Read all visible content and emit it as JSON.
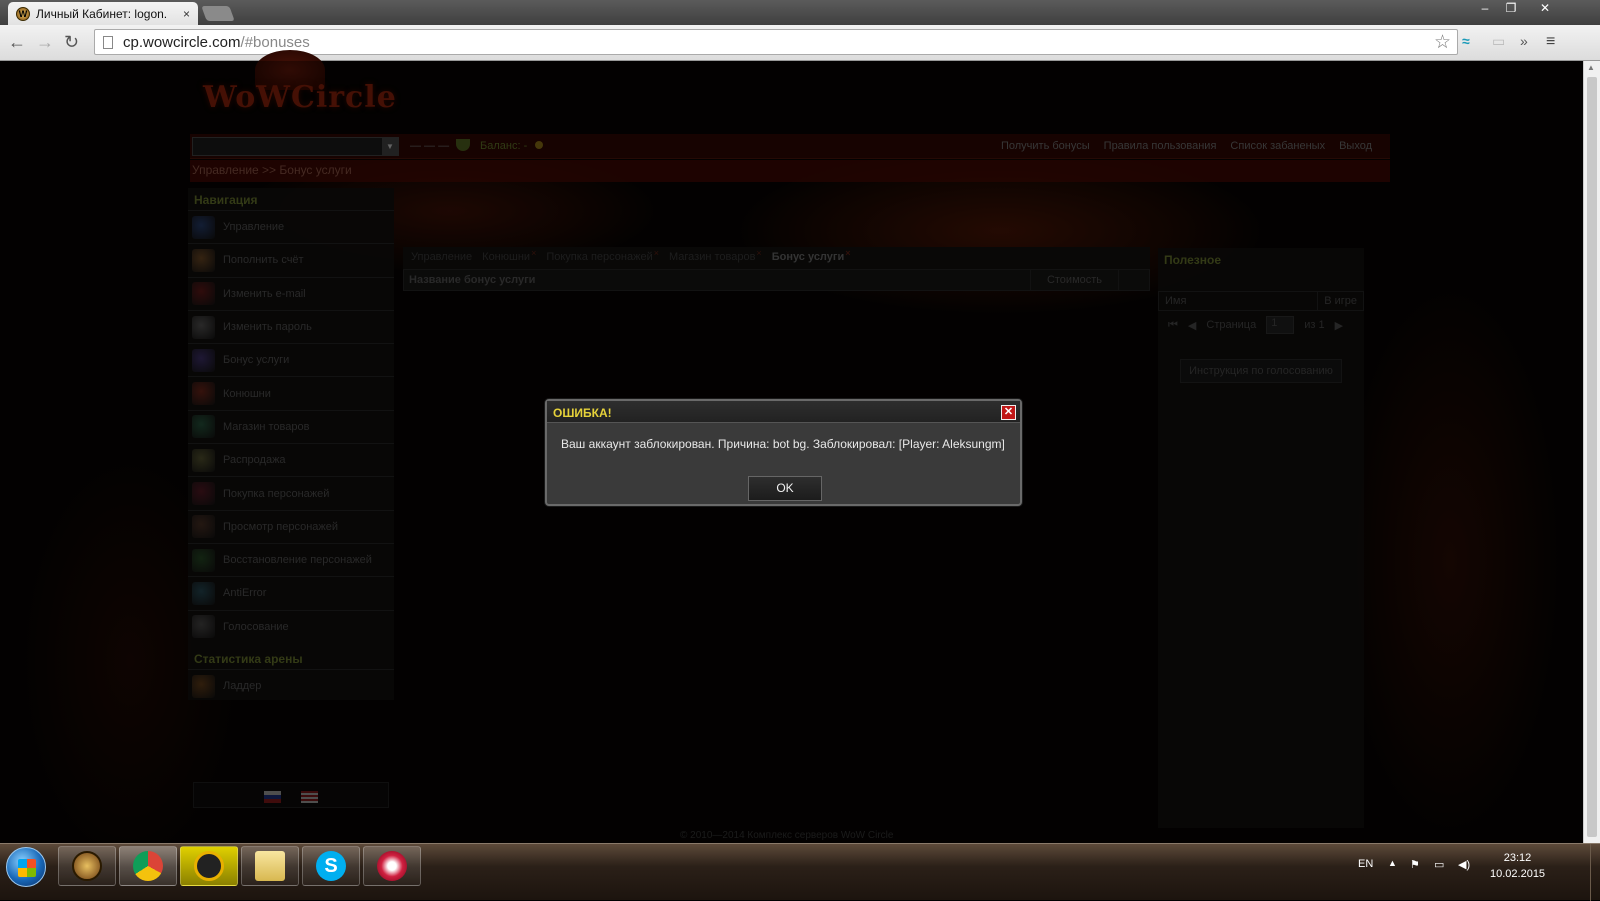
{
  "browser": {
    "tab_title": "Личный Кабинет: logon.",
    "tab_close": "×",
    "url_host": "cp.wowcircle.com",
    "url_rest": "/#bonuses",
    "win_minimize": "–",
    "win_restore": "❐",
    "win_close": "✕"
  },
  "site": {
    "logo_text": "WoWCircle",
    "account_mask": "— — —",
    "balance_label": "Баланс:",
    "balance_value": "-",
    "top_links": [
      "Получить бонусы",
      "Правила пользования",
      "Список забаненых",
      "Выход"
    ],
    "breadcrumb": "Управление >> Бонус услуги"
  },
  "sidebar": {
    "nav_heading": "Навигация",
    "items": [
      {
        "label": "Управление",
        "color": "#2a4a8a"
      },
      {
        "label": "Пополнить счёт",
        "color": "#8a5a2a"
      },
      {
        "label": "Изменить e-mail",
        "color": "#7a1a1a"
      },
      {
        "label": "Изменить пароль",
        "color": "#6a6a6a"
      },
      {
        "label": "Бонус услуги",
        "color": "#4a3a8a"
      },
      {
        "label": "Конюшни",
        "color": "#8a2a1a"
      },
      {
        "label": "Магазин товаров",
        "color": "#2a6a4a"
      },
      {
        "label": "Распродажа",
        "color": "#6a6a3a"
      },
      {
        "label": "Покупка персонажей",
        "color": "#6a1a2a"
      },
      {
        "label": "Просмотр персонажей",
        "color": "#5a3a2a"
      },
      {
        "label": "Восстановление персонажей",
        "color": "#2a5a2a"
      },
      {
        "label": "AntiError",
        "color": "#2a5a6a"
      },
      {
        "label": "Голосование",
        "color": "#5a5a5a"
      }
    ],
    "arena_heading": "Статистика арены",
    "arena_items": [
      {
        "label": "Ладдер",
        "color": "#7a4a1a"
      }
    ]
  },
  "main": {
    "tabs": [
      {
        "label": "Управление",
        "closable": false,
        "active": false
      },
      {
        "label": "Конюшни",
        "closable": true,
        "active": false
      },
      {
        "label": "Покупка персонажей",
        "closable": true,
        "active": false
      },
      {
        "label": "Магазин товаров",
        "closable": true,
        "active": false
      },
      {
        "label": "Бонус услуги",
        "closable": true,
        "active": true
      }
    ],
    "tab_close_glyph": "×",
    "col_name": "Название бонус услуги",
    "col_cost": "Стоимость"
  },
  "right_panel": {
    "title": "Полезное",
    "col_name": "Имя",
    "col_ingame": "В игре",
    "page_label": "Страница",
    "page_value": "1",
    "page_of": "из 1",
    "vote_button": "Инструкция по голосованию"
  },
  "footer": "© 2010—2014 Комплекс серверов WoW Circle",
  "dialog": {
    "title": "ОШИБКА!",
    "message": "Ваш аккаунт заблокирован. Причина: bot bg. Заблокировал: [Player: Aleksungm]",
    "ok_label": "OK",
    "close_glyph": "✕"
  },
  "taskbar": {
    "lang": "EN",
    "time": "23:12",
    "date": "10.02.2015"
  }
}
